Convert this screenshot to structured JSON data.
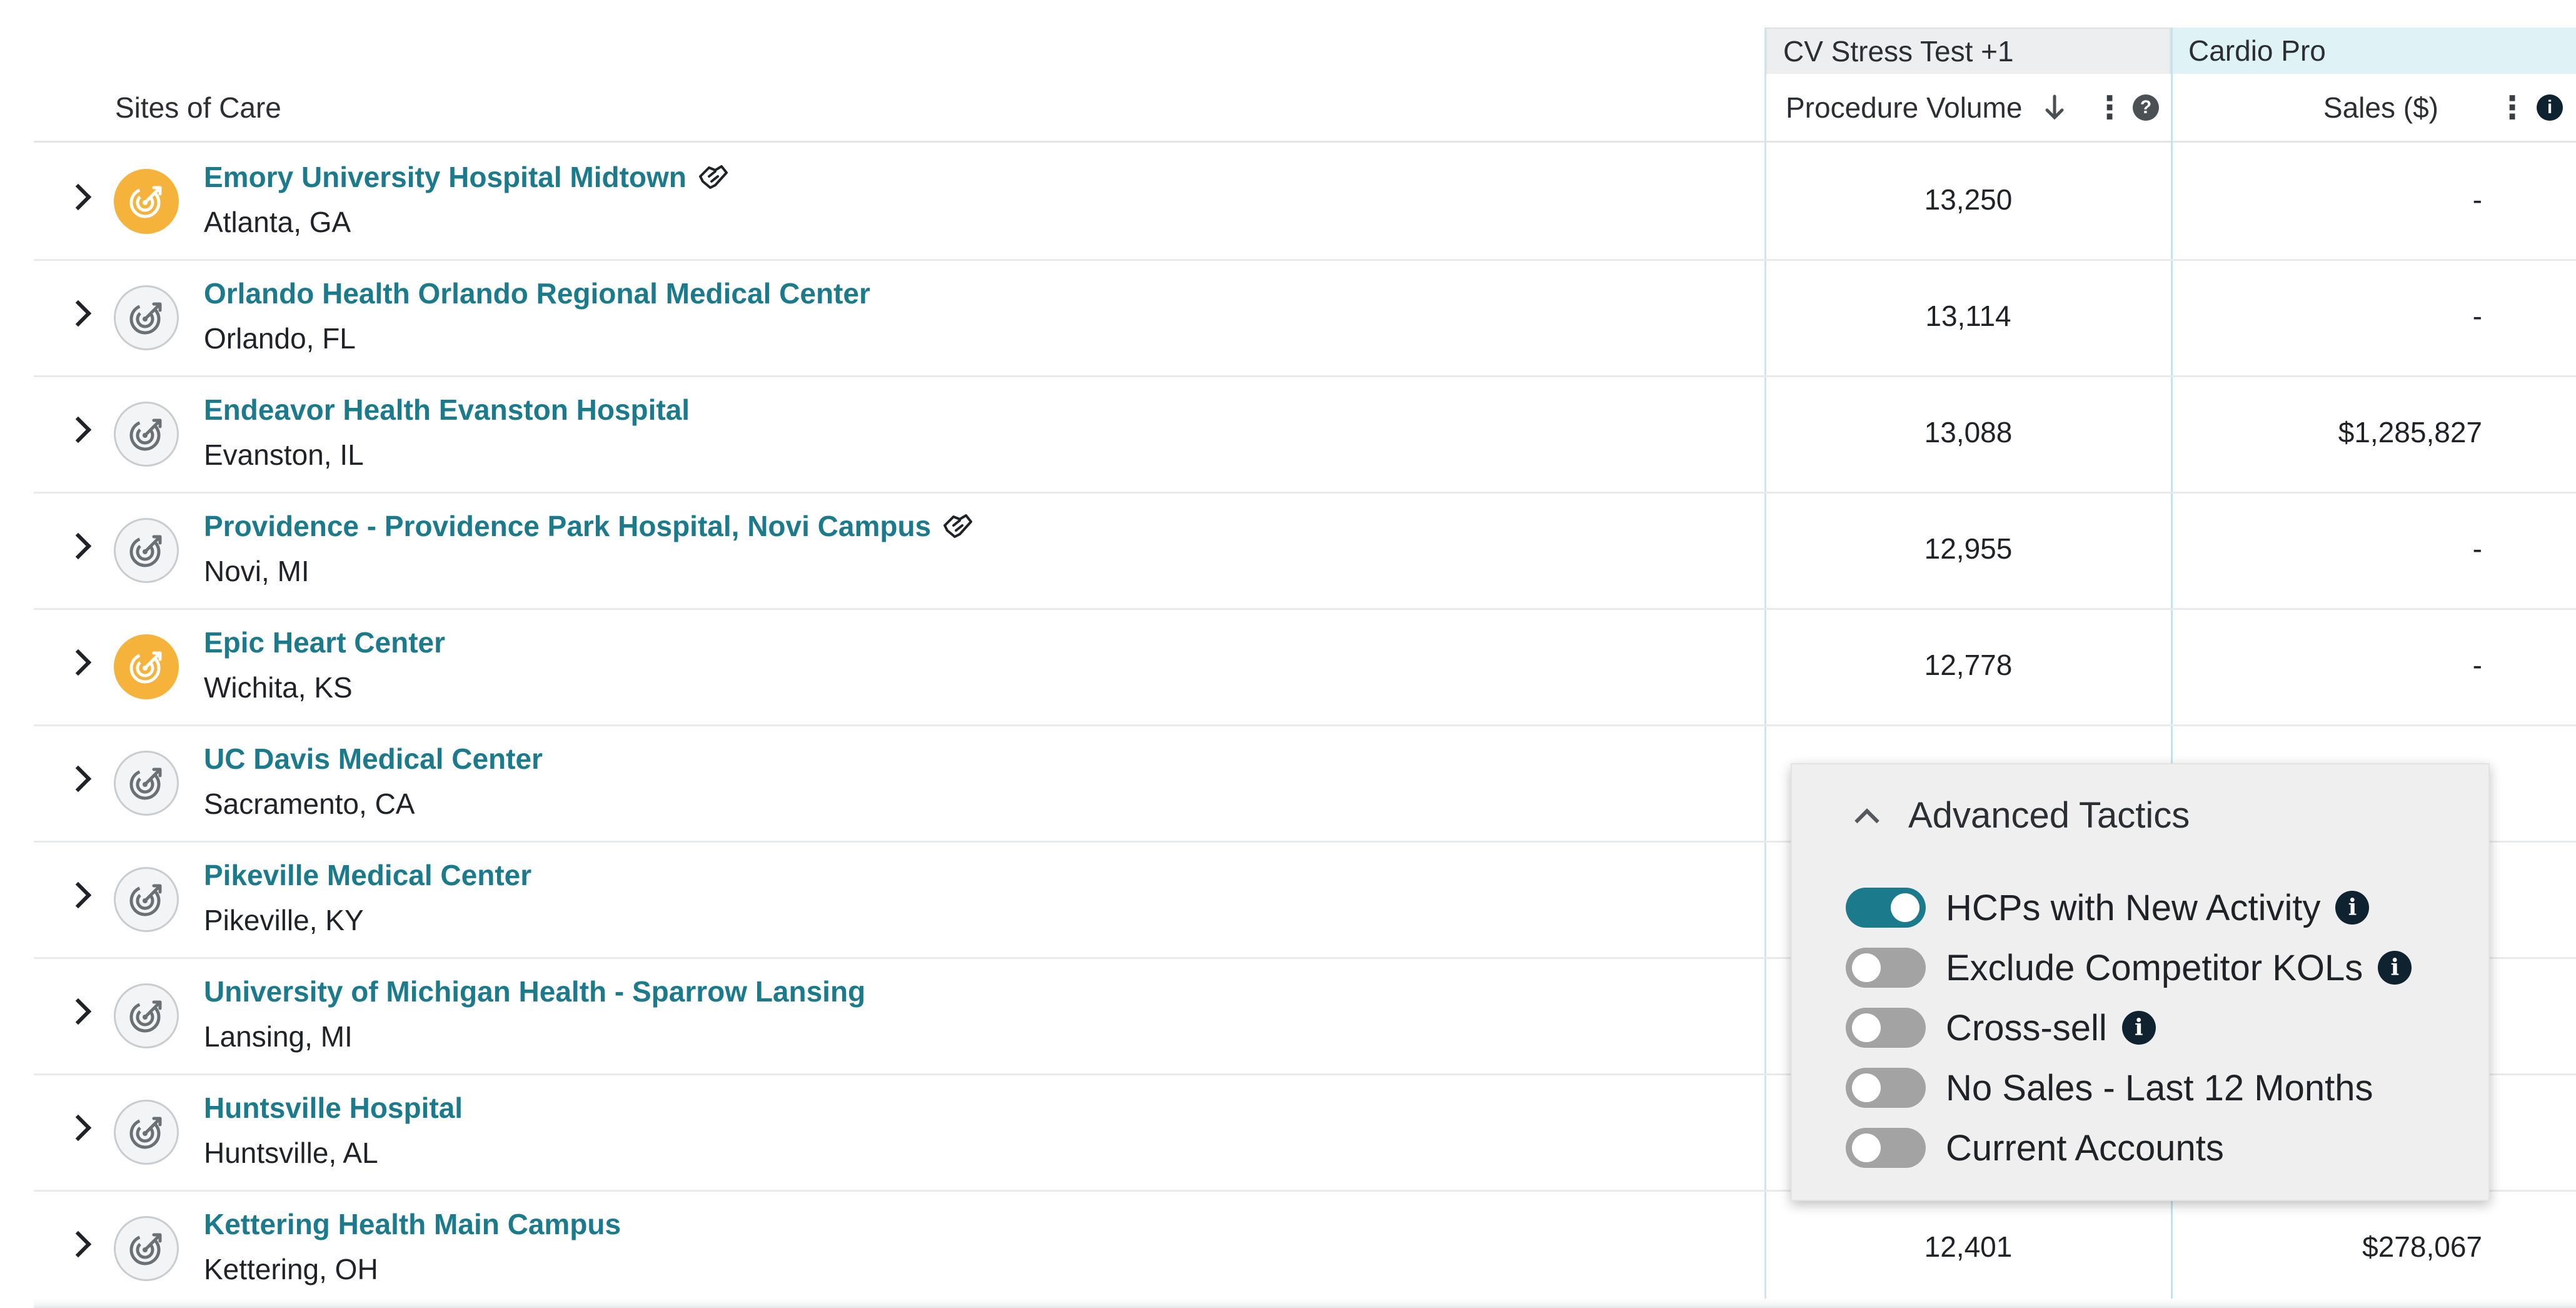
{
  "header": {
    "sites_col": "Sites of Care",
    "group_cv": "CV Stress Test +1",
    "group_cardio": "Cardio Pro",
    "proc_col": "Procedure Volume",
    "sales_col": "Sales ($)",
    "sort_icon": "arrow-down-icon",
    "help_glyph": "?",
    "info_glyph": "i",
    "kebab_glyph": "⋮"
  },
  "rows": [
    {
      "name": "Emory University Hospital Midtown",
      "loc": "Atlanta, GA",
      "proc": "13,250",
      "sales": "-",
      "badge": "orange",
      "hand": true
    },
    {
      "name": "Orlando Health Orlando Regional Medical Center",
      "loc": "Orlando, FL",
      "proc": "13,114",
      "sales": "-",
      "badge": "grey",
      "hand": false
    },
    {
      "name": "Endeavor Health Evanston Hospital",
      "loc": "Evanston, IL",
      "proc": "13,088",
      "sales": "$1,285,827",
      "badge": "grey",
      "hand": false
    },
    {
      "name": "Providence - Providence Park Hospital, Novi Campus",
      "loc": "Novi, MI",
      "proc": "12,955",
      "sales": "-",
      "badge": "grey",
      "hand": true
    },
    {
      "name": "Epic Heart Center",
      "loc": "Wichita, KS",
      "proc": "12,778",
      "sales": "-",
      "badge": "orange",
      "hand": false
    },
    {
      "name": "UC Davis Medical Center",
      "loc": "Sacramento, CA",
      "proc": "",
      "sales": "",
      "badge": "grey",
      "hand": false
    },
    {
      "name": "Pikeville Medical Center",
      "loc": "Pikeville, KY",
      "proc": "",
      "sales": "",
      "badge": "grey",
      "hand": false
    },
    {
      "name": "University of Michigan Health - Sparrow Lansing",
      "loc": "Lansing, MI",
      "proc": "",
      "sales": "",
      "badge": "grey",
      "hand": false
    },
    {
      "name": "Huntsville Hospital",
      "loc": "Huntsville, AL",
      "proc": "",
      "sales": "",
      "badge": "grey",
      "hand": false
    },
    {
      "name": "Kettering Health Main Campus",
      "loc": "Kettering, OH",
      "proc": "12,401",
      "sales": "$278,067",
      "badge": "grey",
      "hand": false
    }
  ],
  "popover": {
    "title": "Advanced Tactics",
    "toggles": [
      {
        "label": "HCPs with New Activity",
        "on": true,
        "info": true
      },
      {
        "label": "Exclude Competitor KOLs",
        "on": false,
        "info": true
      },
      {
        "label": "Cross-sell",
        "on": false,
        "info": true
      },
      {
        "label": "No Sales - Last 12 Months",
        "on": false,
        "info": false
      },
      {
        "label": "Current Accounts",
        "on": false,
        "info": false
      }
    ]
  },
  "colors": {
    "accent": "#1b7b8d",
    "badge_orange": "#f6b33b",
    "cardio_bg": "#dff3f6",
    "cv_bg": "#eceeef"
  }
}
